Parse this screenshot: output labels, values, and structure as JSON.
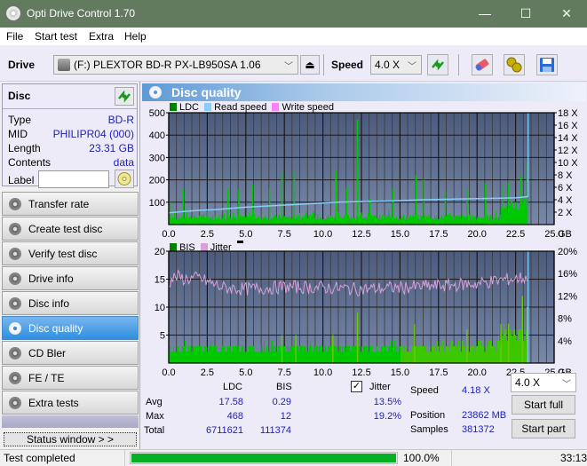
{
  "window": {
    "title": "Opti Drive Control 1.70",
    "minimize": "—",
    "maximize": "☐",
    "close": "✕"
  },
  "menu": [
    "File",
    "Start test",
    "Extra",
    "Help"
  ],
  "toolbar": {
    "drive_label": "Drive",
    "drive_value": "(F:)  PLEXTOR BD-R  PX-LB950SA 1.06",
    "speed_label": "Speed",
    "speed_value": "4.0 X",
    "icons": [
      "eject-icon",
      "refresh-icon",
      "erase-icon",
      "settings-icon",
      "save-icon"
    ]
  },
  "disc": {
    "header": "Disc",
    "rows": [
      {
        "key": "Type",
        "value": "BD-R"
      },
      {
        "key": "MID",
        "value": "PHILIPR04 (000)"
      },
      {
        "key": "Length",
        "value": "23.31 GB"
      },
      {
        "key": "Contents",
        "value": "data"
      }
    ],
    "label_key": "Label",
    "label_value": ""
  },
  "nav": [
    {
      "label": "Transfer rate",
      "active": false
    },
    {
      "label": "Create test disc",
      "active": false
    },
    {
      "label": "Verify test disc",
      "active": false
    },
    {
      "label": "Drive info",
      "active": false
    },
    {
      "label": "Disc info",
      "active": false
    },
    {
      "label": "Disc quality",
      "active": true
    },
    {
      "label": "CD Bler",
      "active": false
    },
    {
      "label": "FE / TE",
      "active": false
    },
    {
      "label": "Extra tests",
      "active": false
    }
  ],
  "status_window_button": "Status window > >",
  "panel": {
    "title": "Disc quality"
  },
  "chart_data": [
    {
      "type": "bar",
      "title": "LDC / Read speed",
      "legend": [
        {
          "name": "LDC",
          "color": "#008000"
        },
        {
          "name": "Read speed",
          "color": "#87cefa"
        },
        {
          "name": "Write speed",
          "color": "#ff80ff"
        }
      ],
      "xlabel": "GB",
      "xlim": [
        0,
        25
      ],
      "xticks": [
        "0.0",
        "2.5",
        "5.0",
        "7.5",
        "10.0",
        "12.5",
        "15.0",
        "17.5",
        "20.0",
        "22.5",
        "25.0"
      ],
      "ylim": [
        0,
        500
      ],
      "yticks": [
        "100",
        "200",
        "300",
        "400",
        "500"
      ],
      "y2lim": [
        0,
        18
      ],
      "y2ticks": [
        "2 X",
        "4 X",
        "6 X",
        "8 X",
        "10 X",
        "12 X",
        "14 X",
        "16 X",
        "18 X"
      ],
      "data_end_gb": 23.31,
      "ldc_baseline": 30,
      "ldc_spikes": [
        [
          0.05,
          100
        ],
        [
          0.9,
          160
        ],
        [
          3.8,
          160
        ],
        [
          4.5,
          155
        ],
        [
          5.4,
          180
        ],
        [
          6.5,
          160
        ],
        [
          7.3,
          235
        ],
        [
          8.1,
          240
        ],
        [
          10.8,
          240
        ],
        [
          11.5,
          165
        ],
        [
          12.2,
          468
        ],
        [
          13.0,
          115
        ],
        [
          14.5,
          160
        ],
        [
          16.0,
          220
        ],
        [
          16.5,
          200
        ],
        [
          17.9,
          150
        ],
        [
          19.3,
          155
        ],
        [
          20.5,
          185
        ],
        [
          21.6,
          175
        ],
        [
          22.0,
          190
        ],
        [
          22.8,
          220
        ],
        [
          23.2,
          280
        ]
      ],
      "read_speed": [
        [
          0,
          1.9
        ],
        [
          1.0,
          2.1
        ],
        [
          2.0,
          2.3
        ],
        [
          3.0,
          2.4
        ],
        [
          4.0,
          2.6
        ],
        [
          5.0,
          2.8
        ],
        [
          6.5,
          3.0
        ],
        [
          8.0,
          3.2
        ],
        [
          9.5,
          3.4
        ],
        [
          11.0,
          3.6
        ],
        [
          12.5,
          3.7
        ],
        [
          14.5,
          3.8
        ],
        [
          16.5,
          4.0
        ],
        [
          18.5,
          4.1
        ],
        [
          20.5,
          4.2
        ],
        [
          22.5,
          4.3
        ],
        [
          23.3,
          4.5
        ]
      ]
    },
    {
      "type": "bar",
      "title": "BIS / Jitter",
      "legend": [
        {
          "name": "BIS",
          "color": "#008000"
        },
        {
          "name": "Jitter",
          "color": "#d8a0d8"
        }
      ],
      "xlabel": "GB",
      "xlim": [
        0,
        25
      ],
      "xticks": [
        "0.0",
        "2.5",
        "5.0",
        "7.5",
        "10.0",
        "12.5",
        "15.0",
        "17.5",
        "20.0",
        "22.5",
        "25.0"
      ],
      "ylim": [
        0,
        20
      ],
      "yticks": [
        "5",
        "10",
        "15",
        "20"
      ],
      "y2lim": [
        0,
        20
      ],
      "y2ticks": [
        "4%",
        "8%",
        "12%",
        "16%",
        "20%"
      ],
      "data_end_gb": 23.31,
      "bis_spikes": [
        [
          7.3,
          5
        ],
        [
          8.2,
          5
        ],
        [
          10.6,
          5
        ],
        [
          12.2,
          9
        ],
        [
          15.9,
          7
        ],
        [
          19.3,
          6
        ],
        [
          21.5,
          7
        ],
        [
          22.0,
          7
        ],
        [
          22.9,
          12
        ],
        [
          23.2,
          10
        ]
      ],
      "jitter_pct": [
        [
          0,
          14.5
        ],
        [
          0.5,
          15.5
        ],
        [
          1.0,
          15.0
        ],
        [
          2.0,
          15.2
        ],
        [
          2.5,
          14.5
        ],
        [
          3.5,
          13.5
        ],
        [
          5.0,
          13.2
        ],
        [
          7.5,
          13.6
        ],
        [
          10.0,
          13.5
        ],
        [
          12.5,
          13.2
        ],
        [
          15.0,
          13.5
        ],
        [
          17.5,
          13.8
        ],
        [
          20.0,
          14.2
        ],
        [
          22.0,
          15.0
        ],
        [
          23.3,
          15.3
        ]
      ]
    }
  ],
  "stats": {
    "col_ldc": "LDC",
    "col_bis": "BIS",
    "jitter_label": "Jitter",
    "jitter_checked": true,
    "rows": [
      {
        "label": "Avg",
        "ldc": "17.58",
        "bis": "0.29",
        "jitter": "13.5%"
      },
      {
        "label": "Max",
        "ldc": "468",
        "bis": "12",
        "jitter": "19.2%"
      },
      {
        "label": "Total",
        "ldc": "6711621",
        "bis": "111374",
        "jitter": ""
      }
    ],
    "speed_label": "Speed",
    "speed_value": "4.18 X",
    "position_label": "Position",
    "position_value": "23862 MB",
    "samples_label": "Samples",
    "samples_value": "381372",
    "speed_select": "4.0 X",
    "start_full": "Start full",
    "start_part": "Start part"
  },
  "statusbar": {
    "text": "Test completed",
    "progress_pct": 100,
    "progress_text": "100.0%",
    "time": "33:13"
  }
}
